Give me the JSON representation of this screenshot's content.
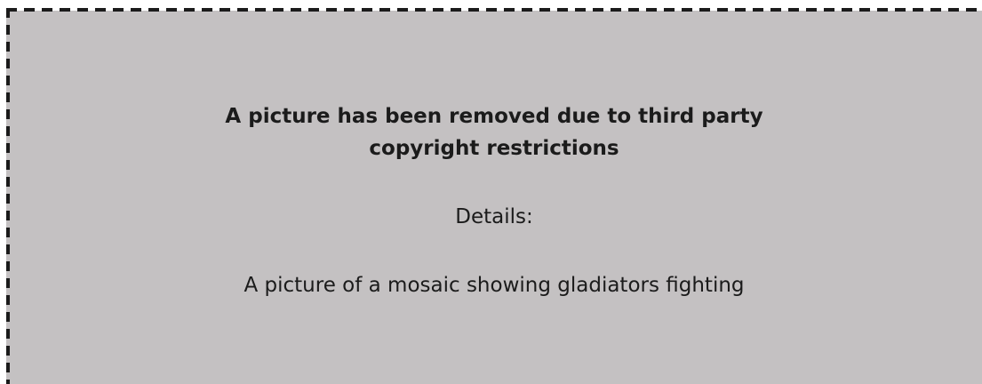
{
  "notice": {
    "heading_line1": "A picture has been removed due to third party",
    "heading_line2": "copyright restrictions",
    "details_label": "Details:",
    "details_text": "A picture of a mosaic showing gladiators fighting",
    "colors": {
      "background": "#c4c1c2",
      "border": "#1b1b1b",
      "text": "#1b1b1b"
    }
  }
}
